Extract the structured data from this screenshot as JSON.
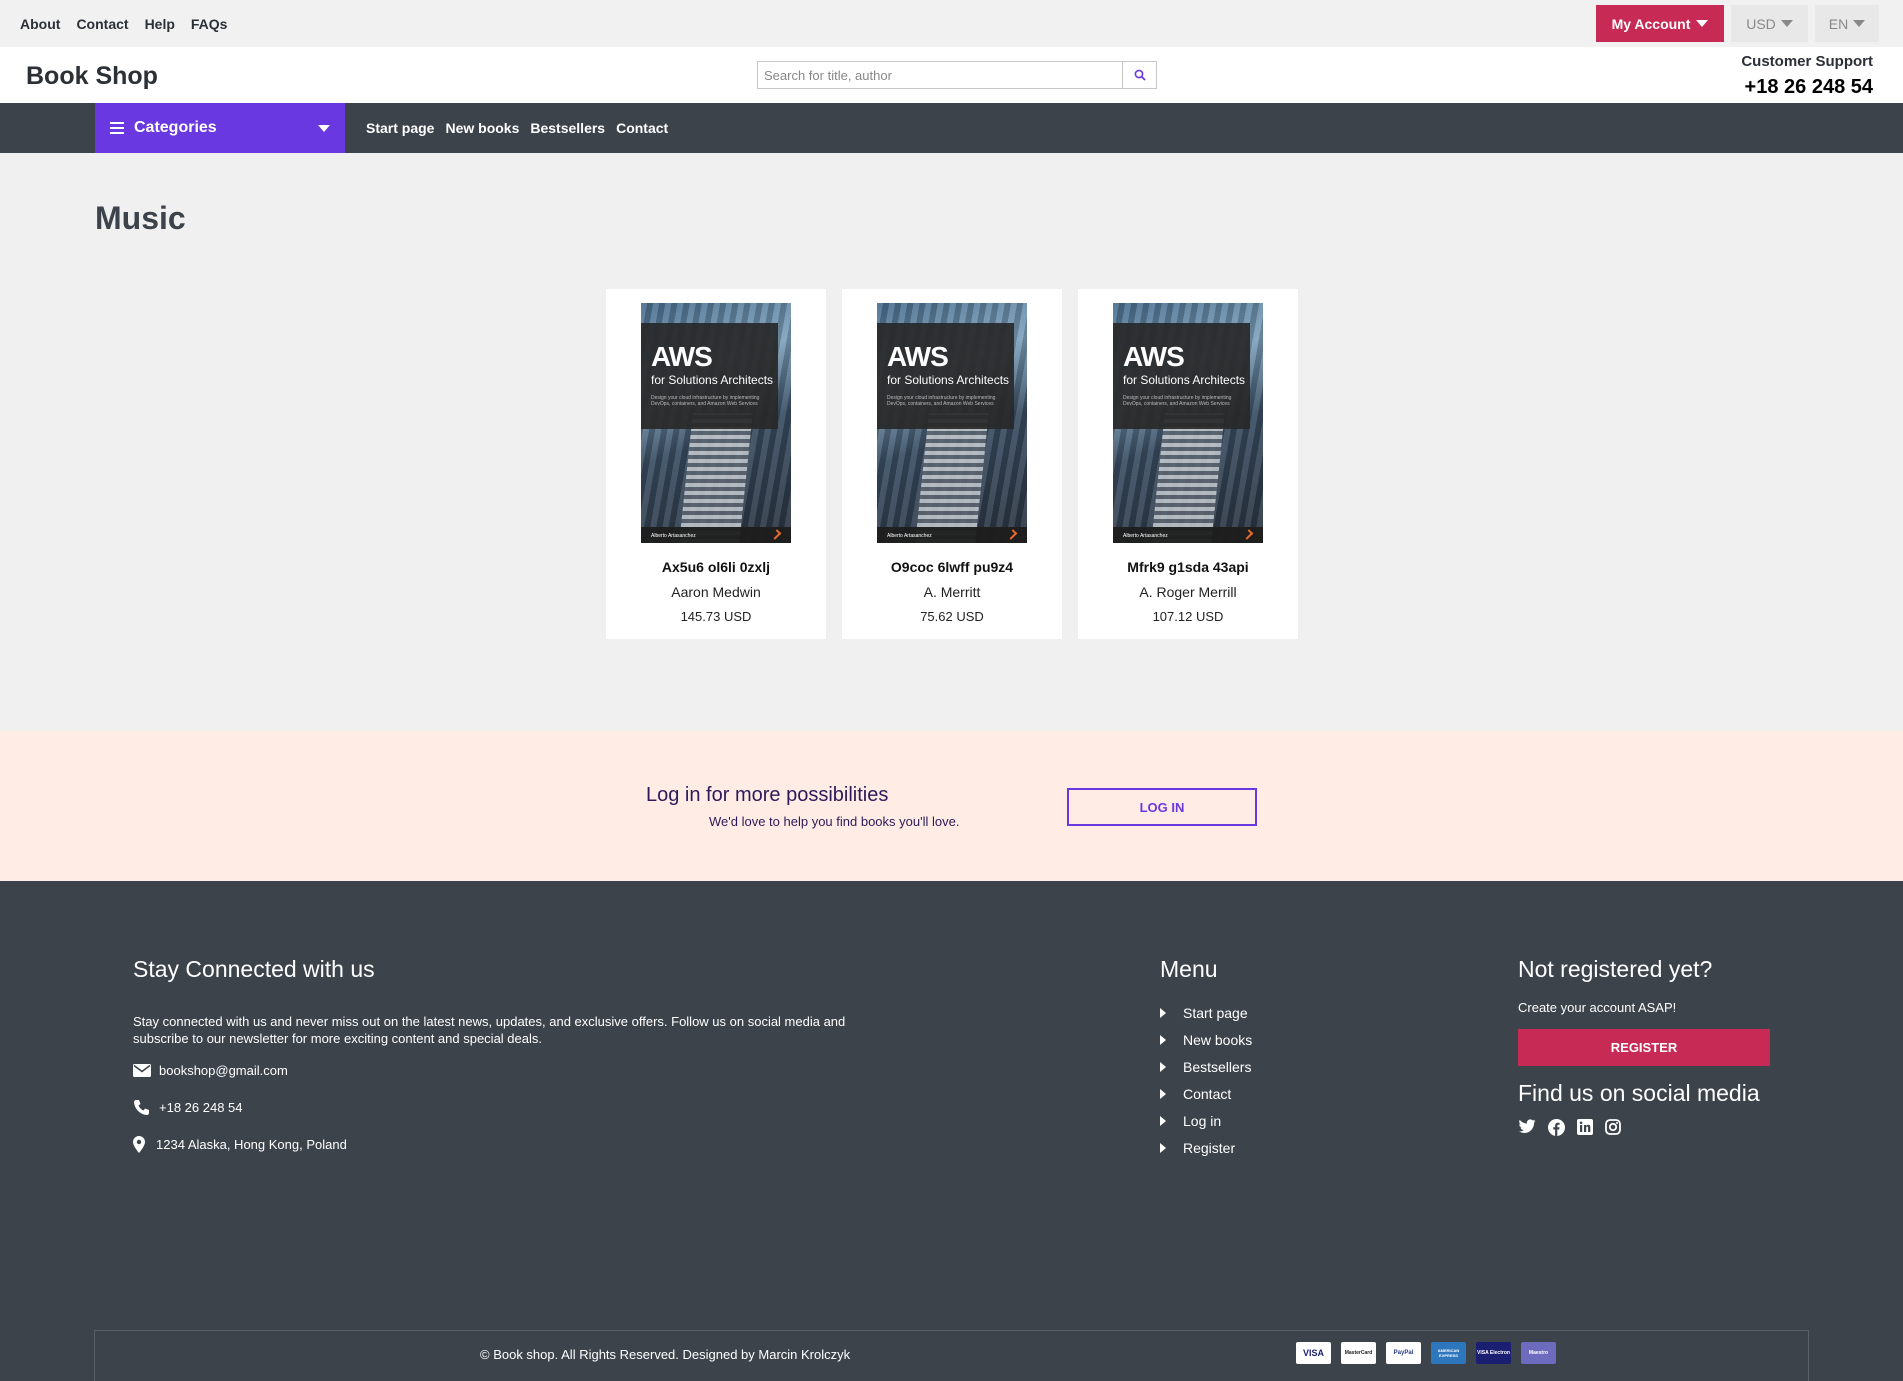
{
  "topbar": {
    "links": [
      "About",
      "Contact",
      "Help",
      "FAQs"
    ],
    "my_account": "My Account",
    "currency": "USD",
    "language": "EN"
  },
  "header": {
    "brand": "Book Shop",
    "search_placeholder": "Search for title, author",
    "support_label": "Customer Support",
    "support_phone": "+18 26 248 54"
  },
  "nav": {
    "categories_label": "Categories",
    "links": [
      "Start page",
      "New books",
      "Bestsellers",
      "Contact"
    ]
  },
  "main": {
    "title": "Music",
    "products": [
      {
        "title": "Ax5u6 ol6li 0zxlj",
        "author": "Aaron Medwin",
        "price": "145.73 USD"
      },
      {
        "title": "O9coc 6lwff pu9z4",
        "author": "A. Merritt",
        "price": "75.62 USD"
      },
      {
        "title": "Mfrk9 g1sda 43api",
        "author": "A. Roger Merrill",
        "price": "107.12 USD"
      }
    ],
    "cover": {
      "title": "AWS",
      "subtitle": "for Solutions Architects",
      "blurb": "Design your cloud infrastructure by implementing DevOps, containers, and Amazon Web Services",
      "author": "Alberto Artasanchez"
    }
  },
  "login_band": {
    "heading": "Log in for more possibilities",
    "subtext": "We'd love to help you find books you'll love.",
    "button": "LOG IN"
  },
  "footer": {
    "connect_heading": "Stay Connected with us",
    "connect_text": "Stay connected with us and never miss out on the latest news, updates, and exclusive offers. Follow us on social media and subscribe to our newsletter for more exciting content and special deals.",
    "email": "bookshop@gmail.com",
    "phone": "+18 26 248 54",
    "address": "1234 Alaska, Hong Kong, Poland",
    "menu_heading": "Menu",
    "menu_items": [
      "Start page",
      "New books",
      "Bestsellers",
      "Contact",
      "Log in",
      "Register"
    ],
    "register_heading": "Not registered yet?",
    "register_sub": "Create your account ASAP!",
    "register_button": "REGISTER",
    "social_heading": "Find us on social media",
    "social_icons": [
      "twitter-icon",
      "facebook-icon",
      "linkedin-icon",
      "instagram-icon"
    ],
    "copyright": "© Book shop. All Rights Reserved. Designed by Marcin Krolczyk",
    "payment_cards": [
      "VISA",
      "MasterCard",
      "PayPal",
      "AMERICAN EXPRESS",
      "VISA Electron",
      "Maestro"
    ]
  },
  "colors": {
    "accent_purple": "#6a38e0",
    "accent_red": "#c62a55",
    "dark": "#3c434b",
    "band": "#ffede5"
  }
}
